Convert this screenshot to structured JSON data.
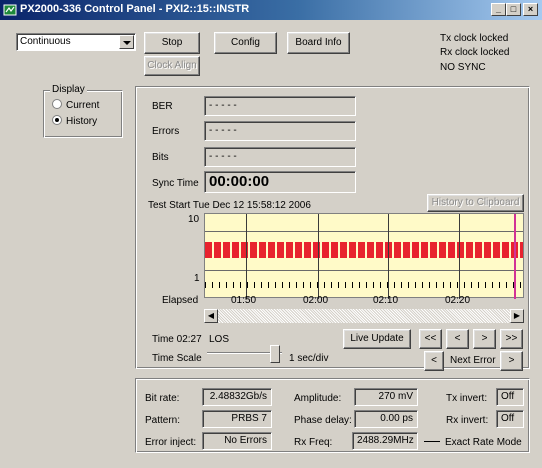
{
  "window": {
    "title": "PX2000-336 Control Panel - PXI2::15::INSTR",
    "controls": [
      "_",
      "□",
      "×"
    ]
  },
  "mode_select": {
    "value": "Continuous"
  },
  "buttons": {
    "stop": "Stop",
    "config": "Config",
    "board_info": "Board Info",
    "clock_align": "Clock Align"
  },
  "status": {
    "tx": "Tx clock locked",
    "rx": "Rx clock locked",
    "sync": "NO SYNC"
  },
  "display": {
    "label": "Display",
    "options": [
      "Current",
      "History"
    ],
    "selected": "History"
  },
  "metrics": {
    "ber_label": "BER",
    "ber_value": "- - - - -",
    "errors_label": "Errors",
    "errors_value": "- - - - -",
    "bits_label": "Bits",
    "bits_value": "- - - - -",
    "sync_time_label": "Sync Time",
    "sync_time_value": "00:00:00"
  },
  "history": {
    "test_start": "Test Start Tue Dec 12 15:58:12 2006",
    "copy_button": "History to Clipboard",
    "y_top": "10",
    "y_bottom": "1",
    "x_label": "Elapsed",
    "x_ticks": [
      "01:50",
      "02:00",
      "02:10",
      "02:20"
    ],
    "time_text": "Time 02:27",
    "los_text": "LOS",
    "live_update": "Live Update",
    "nav": [
      "<<",
      "<",
      ">",
      ">>"
    ],
    "next_error_prev": "<",
    "next_error_label": "Next Error",
    "next_error_next": ">",
    "time_scale_label": "Time Scale",
    "time_scale_value": "1 sec/div"
  },
  "settings": {
    "bit_rate_label": "Bit rate:",
    "bit_rate": "2.48832Gb/s",
    "pattern_label": "Pattern:",
    "pattern": "PRBS 7",
    "error_inject_label": "Error inject:",
    "error_inject": "No Errors",
    "amplitude_label": "Amplitude:",
    "amplitude": "270 mV",
    "phase_delay_label": "Phase delay:",
    "phase_delay": "0.00 ps",
    "rx_freq_label": "Rx Freq:",
    "rx_freq": "2488.29MHz",
    "tx_invert_label": "Tx invert:",
    "tx_invert": "Off",
    "rx_invert_label": "Rx invert:",
    "rx_invert": "Off",
    "exact_rate": "Exact Rate Mode"
  },
  "colors": {
    "plot_bg": "#fffac8",
    "error_band": "#e8222e",
    "cursor": "#d23296",
    "titlebar": "#0a246a"
  }
}
